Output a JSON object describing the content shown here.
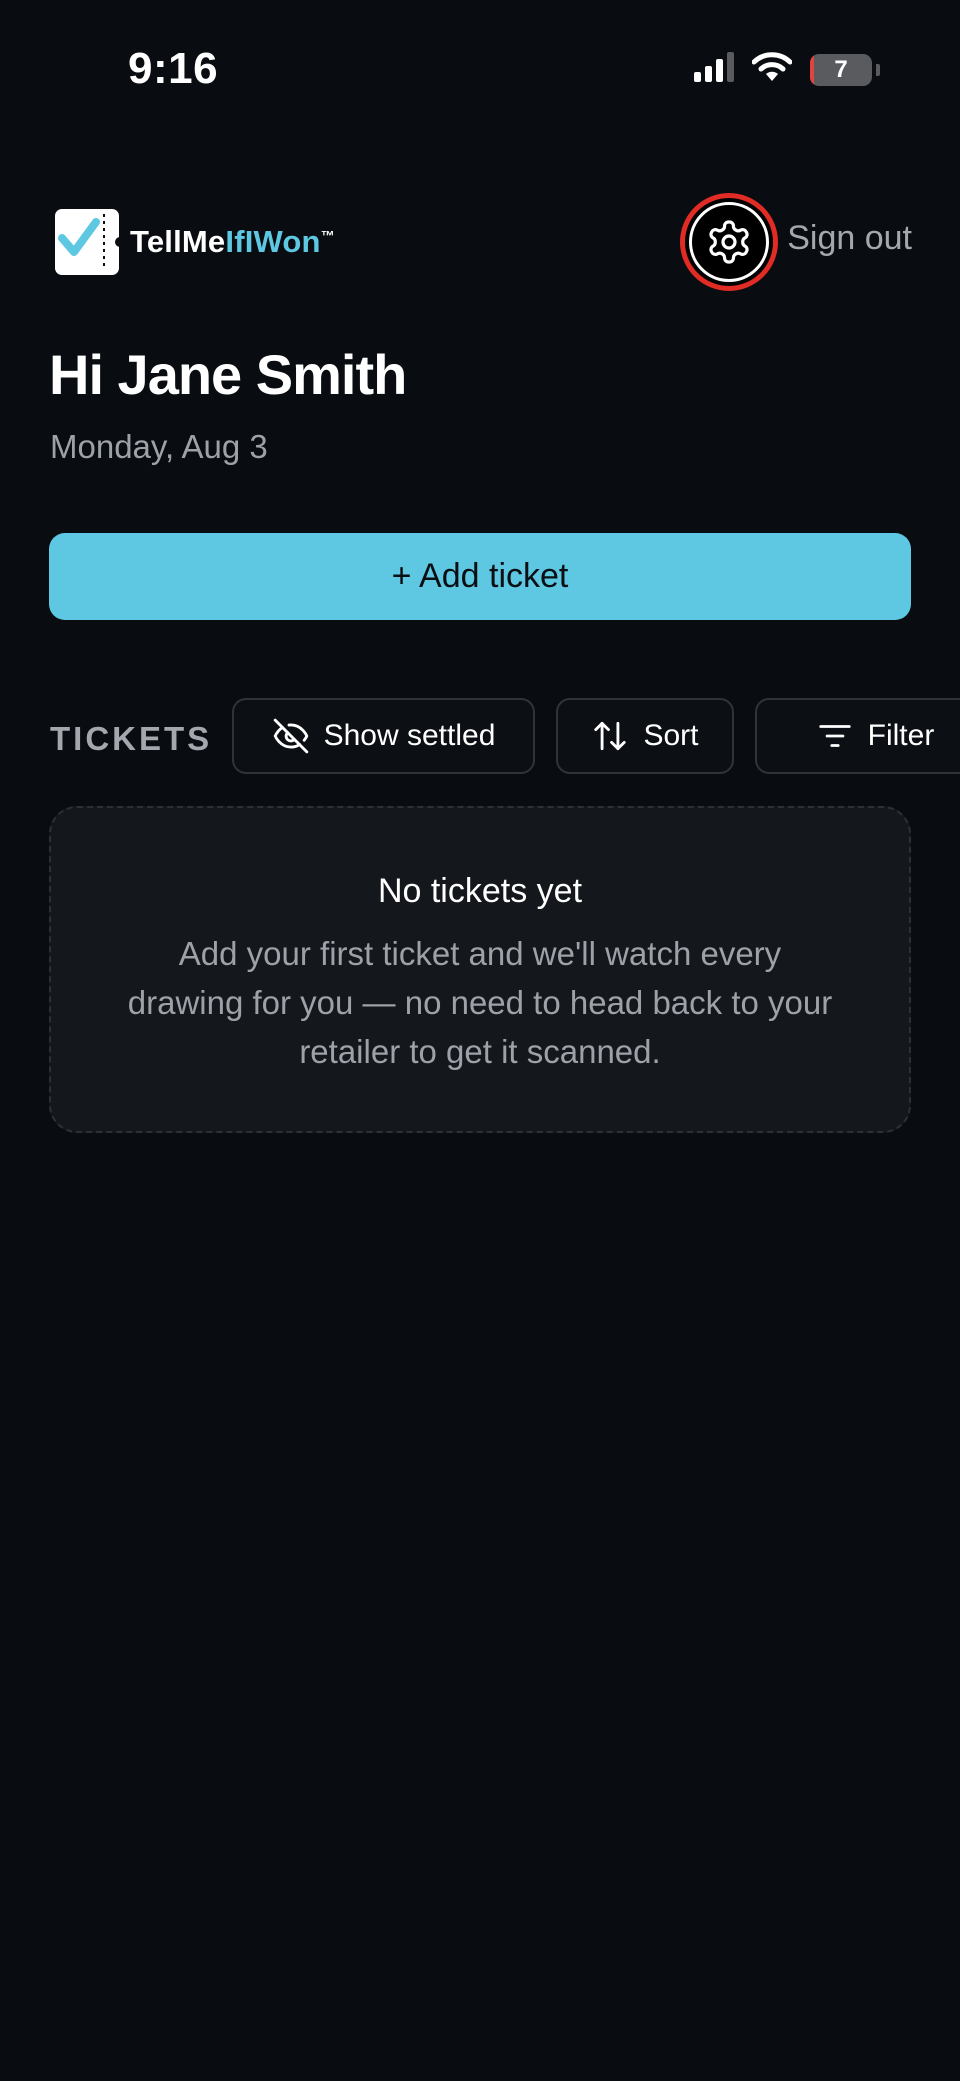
{
  "status_bar": {
    "time": "9:16",
    "battery_level": "7",
    "battery_fraction": 0.07,
    "icons": [
      "cellular-signal-icon",
      "wifi-icon",
      "battery-icon"
    ]
  },
  "header": {
    "logo": {
      "part1": "TellMe",
      "part2": "IfIWon",
      "trademark": "™"
    },
    "settings_icon": "gear-icon",
    "sign_out_label": "Sign out"
  },
  "greeting": {
    "title": "Hi Jane Smith",
    "date": "Monday, Aug 3"
  },
  "add_ticket_label": "+ Add ticket",
  "tickets": {
    "section_label": "TICKETS",
    "show_settled_label": "Show settled",
    "sort_label": "Sort",
    "filter_label": "Filter",
    "empty_state": {
      "title": "No tickets yet",
      "body": "Add your first ticket and we'll watch every drawing for you — no need to head back to your retailer to get it scanned."
    }
  },
  "colors": {
    "background": "#090c10",
    "accent": "#5ec8e3",
    "highlight_ring": "#e12b25",
    "muted_text": "#9da1a8",
    "card_background": "#14171c"
  }
}
